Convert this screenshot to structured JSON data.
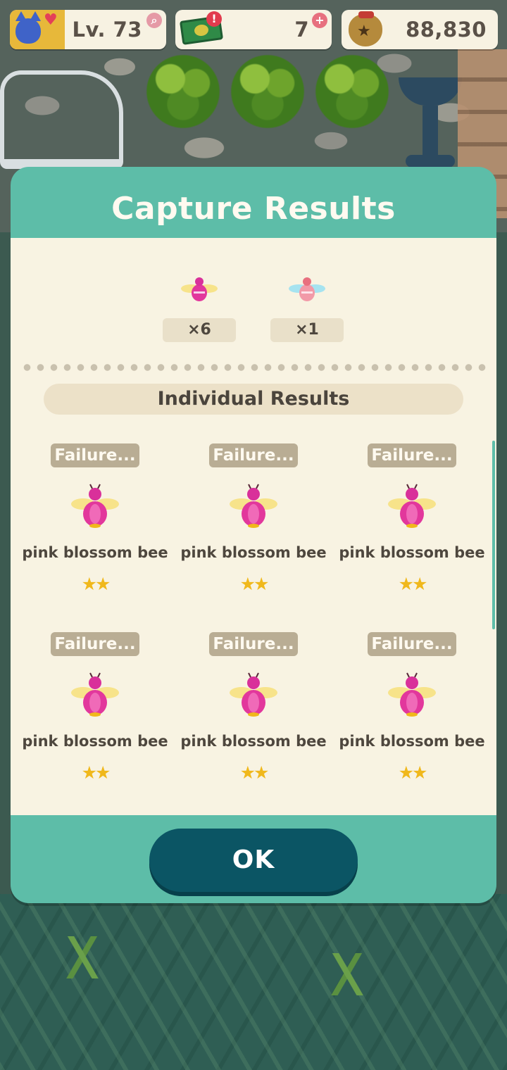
{
  "hud": {
    "level_label": "Lv. 73",
    "tickets": "7",
    "bells": "88,830",
    "alert_badge": "!",
    "plus_badge": "+",
    "search_badge": "⌕"
  },
  "dialog": {
    "title": "Capture Results",
    "summary": [
      {
        "icon": "pink-blossom-bee-icon",
        "count_label": "×6"
      },
      {
        "icon": "pink-blossom-bee-alt-icon",
        "count_label": "×1"
      }
    ],
    "section_title": "Individual Results",
    "results": [
      {
        "status": "Failure...",
        "name": "pink blossom bee",
        "stars": "★★"
      },
      {
        "status": "Failure...",
        "name": "pink blossom bee",
        "stars": "★★"
      },
      {
        "status": "Failure...",
        "name": "pink blossom bee",
        "stars": "★★"
      },
      {
        "status": "Failure...",
        "name": "pink blossom bee",
        "stars": "★★"
      },
      {
        "status": "Failure...",
        "name": "pink blossom bee",
        "stars": "★★"
      },
      {
        "status": "Failure...",
        "name": "pink blossom bee",
        "stars": "★★"
      }
    ],
    "ok_label": "OK"
  },
  "colors": {
    "dialog_frame": "#5dbda8",
    "dialog_body": "#f8f3e2",
    "ok_button": "#0b5564",
    "star": "#f0b81c",
    "bee_pink": "#e2379c"
  }
}
